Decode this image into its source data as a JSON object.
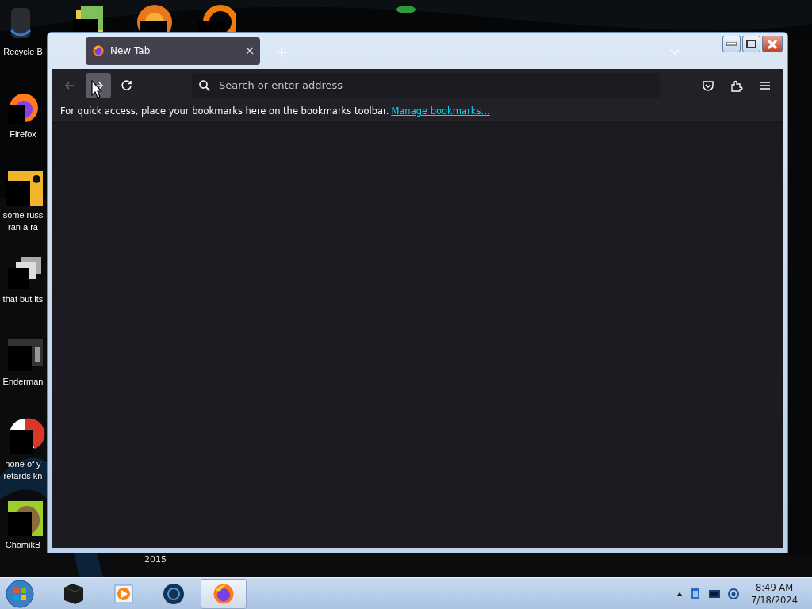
{
  "desktop": {
    "icons": [
      {
        "kind": "recycle",
        "lines": [
          "Recycle B"
        ]
      },
      {
        "kind": "firefox",
        "lines": [
          "Firefox"
        ]
      },
      {
        "kind": "yellow",
        "lines": [
          "some russ",
          "ran a ra"
        ]
      },
      {
        "kind": "windows",
        "lines": [
          "that but its"
        ]
      },
      {
        "kind": "dark",
        "lines": [
          "Enderman"
        ]
      },
      {
        "kind": "redcircle",
        "lines": [
          "none of y",
          "retards kn"
        ]
      },
      {
        "kind": "hamster",
        "lines": [
          "ChomikB"
        ]
      }
    ],
    "top_icons": [
      {
        "kind": "folder"
      },
      {
        "kind": "orange"
      },
      {
        "kind": "ring"
      }
    ],
    "caption": "2015"
  },
  "browser": {
    "tabs": [
      {
        "title": "New Tab",
        "selected": true
      }
    ],
    "nav": [
      {
        "kind": "back",
        "disabled": true,
        "hovered": false
      },
      {
        "kind": "forward",
        "disabled": false,
        "hovered": true
      },
      {
        "kind": "reload",
        "disabled": false,
        "hovered": false
      }
    ],
    "address": {
      "placeholder": "Search or enter address"
    },
    "bookmarks": {
      "text": "For quick access, place your bookmarks here on the bookmarks toolbar.",
      "link": "Manage bookmarks…"
    }
  },
  "taskbar": {
    "apps": [
      {
        "kind": "box",
        "selected": false
      },
      {
        "kind": "player",
        "selected": false
      },
      {
        "kind": "globe",
        "selected": false
      },
      {
        "kind": "firefox",
        "selected": true
      }
    ],
    "clock": {
      "time": "8:49 AM",
      "date": "7/18/2024"
    }
  }
}
